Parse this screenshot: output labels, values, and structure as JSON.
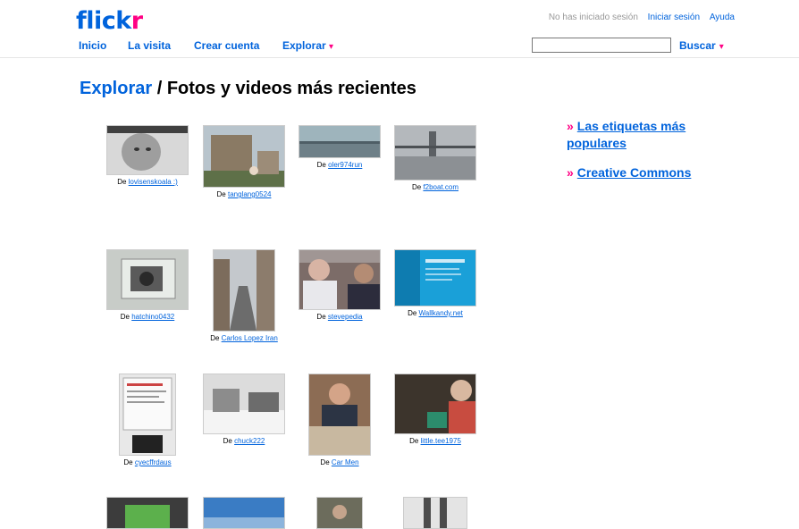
{
  "logo": {
    "part1": "flick",
    "part2": "r"
  },
  "nav": {
    "items": [
      "Inicio",
      "La visita",
      "Crear cuenta",
      "Explorar"
    ],
    "caret": "▾"
  },
  "status": {
    "not_logged_in": "No has iniciado sesión",
    "login": "Iniciar sesión",
    "help": "Ayuda"
  },
  "search": {
    "value": "",
    "button": "Buscar",
    "caret": "▾"
  },
  "page": {
    "crumb": "Explorar",
    "separator": " / ",
    "title": "Fotos y videos más recientes"
  },
  "caption_prefix": "De ",
  "photos": [
    {
      "user": "lovisenskoala :)"
    },
    {
      "user": "tanglang0524"
    },
    {
      "user": "oler974run"
    },
    {
      "user": "f2boat.com"
    },
    {
      "user": "hatchino0432"
    },
    {
      "user": "Carlos Lopez Iran"
    },
    {
      "user": "stevepedia"
    },
    {
      "user": "Wallkandy.net"
    },
    {
      "user": "cyecffrdaus"
    },
    {
      "user": "chuck222"
    },
    {
      "user": "Car Men"
    },
    {
      "user": "little.tee1975"
    },
    {
      "user": ""
    },
    {
      "user": ""
    },
    {
      "user": ""
    },
    {
      "user": ""
    }
  ],
  "sidebar": {
    "bullet": "»",
    "links": [
      "Las etiquetas más populares",
      "Creative Commons"
    ]
  }
}
